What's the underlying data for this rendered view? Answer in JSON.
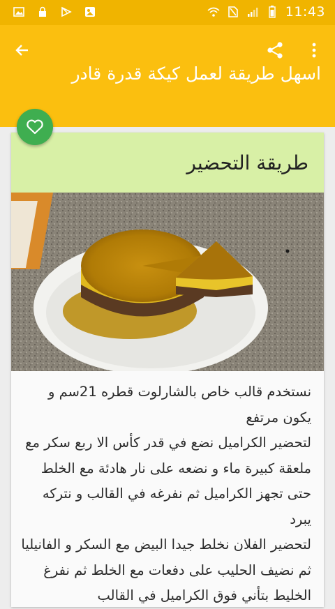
{
  "status_bar": {
    "time": "11:43",
    "left_icons": [
      "image-icon",
      "lock-icon",
      "play-store-icon",
      "gallery-icon"
    ],
    "right_icons": [
      "wifi-icon",
      "no-sim-icon",
      "signal-icon",
      "battery-icon"
    ]
  },
  "app_bar": {
    "title": "اسهل طريقة لعمل كيكة قدرة قادر",
    "background": "#fbbf0f",
    "status_background": "#f0b400"
  },
  "card": {
    "header_title": "طريقة التحضير",
    "header_background": "#d8f0a6",
    "fav_color": "#3fae50",
    "paragraphs": [
      "نستخدم قالب خاص بالشارلوت قطره 21سم و يكون مرتفع",
      "لتحضير الكراميل نضع في قدر كأس الا ربع سكر مع ملعقة كبيرة ماء و نضعه على نار هادئة مع الخلط حتى تجهز الكراميل ثم نفرغه في القالب و نتركه يبرد",
      "لتحضير الفلان نخلط جيدا البيض مع السكر و الفانيليا ثم نضيف الحليب على دفعات مع الخلط ثم نفرغ الخليط بتأني فوق الكراميل في القالب"
    ]
  }
}
